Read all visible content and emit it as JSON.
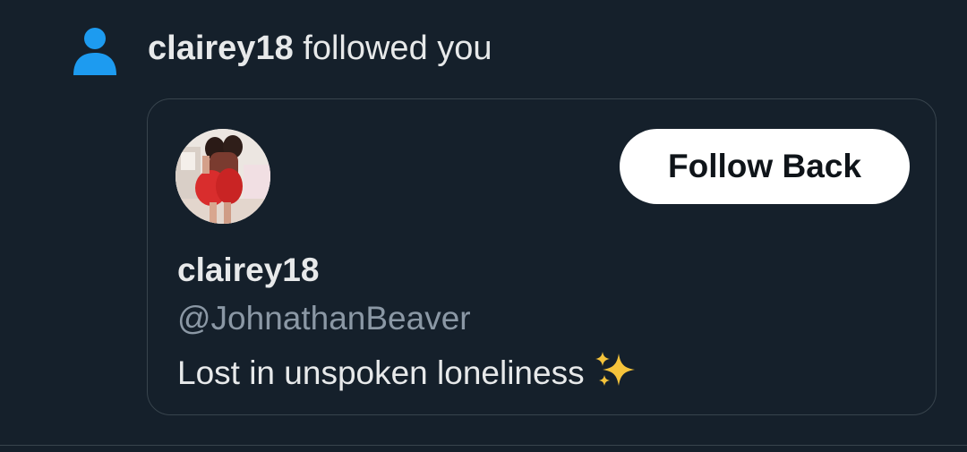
{
  "notification": {
    "icon": "person-icon",
    "username": "clairey18",
    "action": " followed you"
  },
  "card": {
    "follow_button_label": "Follow Back",
    "display_name": "clairey18",
    "handle": "@JohnathanBeaver",
    "bio": "Lost in unspoken loneliness ",
    "bio_emoji": "sparkles-icon"
  },
  "colors": {
    "background": "#15202b",
    "accent_blue": "#1d9bf0",
    "text_primary": "#e7e9ea",
    "text_secondary": "#8b98a5",
    "border": "#38444d",
    "button_bg": "#ffffff"
  }
}
